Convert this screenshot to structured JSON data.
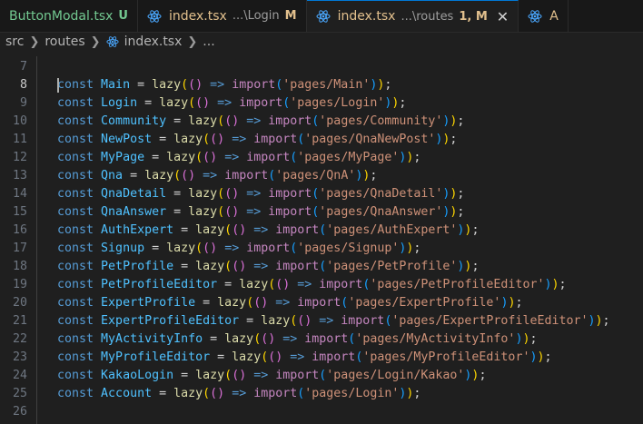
{
  "tabs": [
    {
      "name": "ButtonModal.tsx",
      "badge": "U",
      "status": "untracked"
    },
    {
      "name": "index.tsx",
      "description": "...\\Login",
      "badge": "M",
      "status": "modified"
    },
    {
      "name": "index.tsx",
      "description": "...\\routes",
      "badge": "1, M",
      "status": "modified",
      "active": true,
      "close": "✕"
    },
    {
      "name": "A",
      "status": "modified"
    }
  ],
  "breadcrumb": {
    "items": [
      "src",
      "routes",
      "index.tsx",
      "..."
    ]
  },
  "editor": {
    "current_line": "8",
    "first_line_number": "7",
    "lines": [
      {
        "n": "8",
        "name": "Main",
        "path": "'pages/Main'"
      },
      {
        "n": "9",
        "name": "Login",
        "path": "'pages/Login'"
      },
      {
        "n": "10",
        "name": "Community",
        "path": "'pages/Community'"
      },
      {
        "n": "11",
        "name": "NewPost",
        "path": "'pages/QnaNewPost'"
      },
      {
        "n": "12",
        "name": "MyPage",
        "path": "'pages/MyPage'"
      },
      {
        "n": "13",
        "name": "Qna",
        "path": "'pages/QnA'"
      },
      {
        "n": "14",
        "name": "QnaDetail",
        "path": "'pages/QnaDetail'"
      },
      {
        "n": "15",
        "name": "QnaAnswer",
        "path": "'pages/QnaAnswer'"
      },
      {
        "n": "16",
        "name": "AuthExpert",
        "path": "'pages/AuthExpert'"
      },
      {
        "n": "17",
        "name": "Signup",
        "path": "'pages/Signup'"
      },
      {
        "n": "18",
        "name": "PetProfile",
        "path": "'pages/PetProfile'"
      },
      {
        "n": "19",
        "name": "PetProfileEditor",
        "path": "'pages/PetProfileEditor'"
      },
      {
        "n": "20",
        "name": "ExpertProfile",
        "path": "'pages/ExpertProfile'"
      },
      {
        "n": "21",
        "name": "ExpertProfileEditor",
        "path": "'pages/ExpertProfileEditor'"
      },
      {
        "n": "22",
        "name": "MyActivityInfo",
        "path": "'pages/MyActivityInfo'"
      },
      {
        "n": "23",
        "name": "MyProfileEditor",
        "path": "'pages/MyProfileEditor'"
      },
      {
        "n": "24",
        "name": "KakaoLogin",
        "path": "'pages/Login/Kakao'"
      },
      {
        "n": "25",
        "name": "Account",
        "path": "'pages/Login'"
      }
    ],
    "last_line_number": "26",
    "tokens": {
      "const": "const",
      "eq": " = ",
      "lazy": "lazy",
      "arrow": " => ",
      "import": "import",
      "end": ";"
    }
  },
  "colors": {
    "accent": "#0078d4",
    "keyword": "#569cd6",
    "string": "#ce9178",
    "function": "#dcdcaa"
  }
}
